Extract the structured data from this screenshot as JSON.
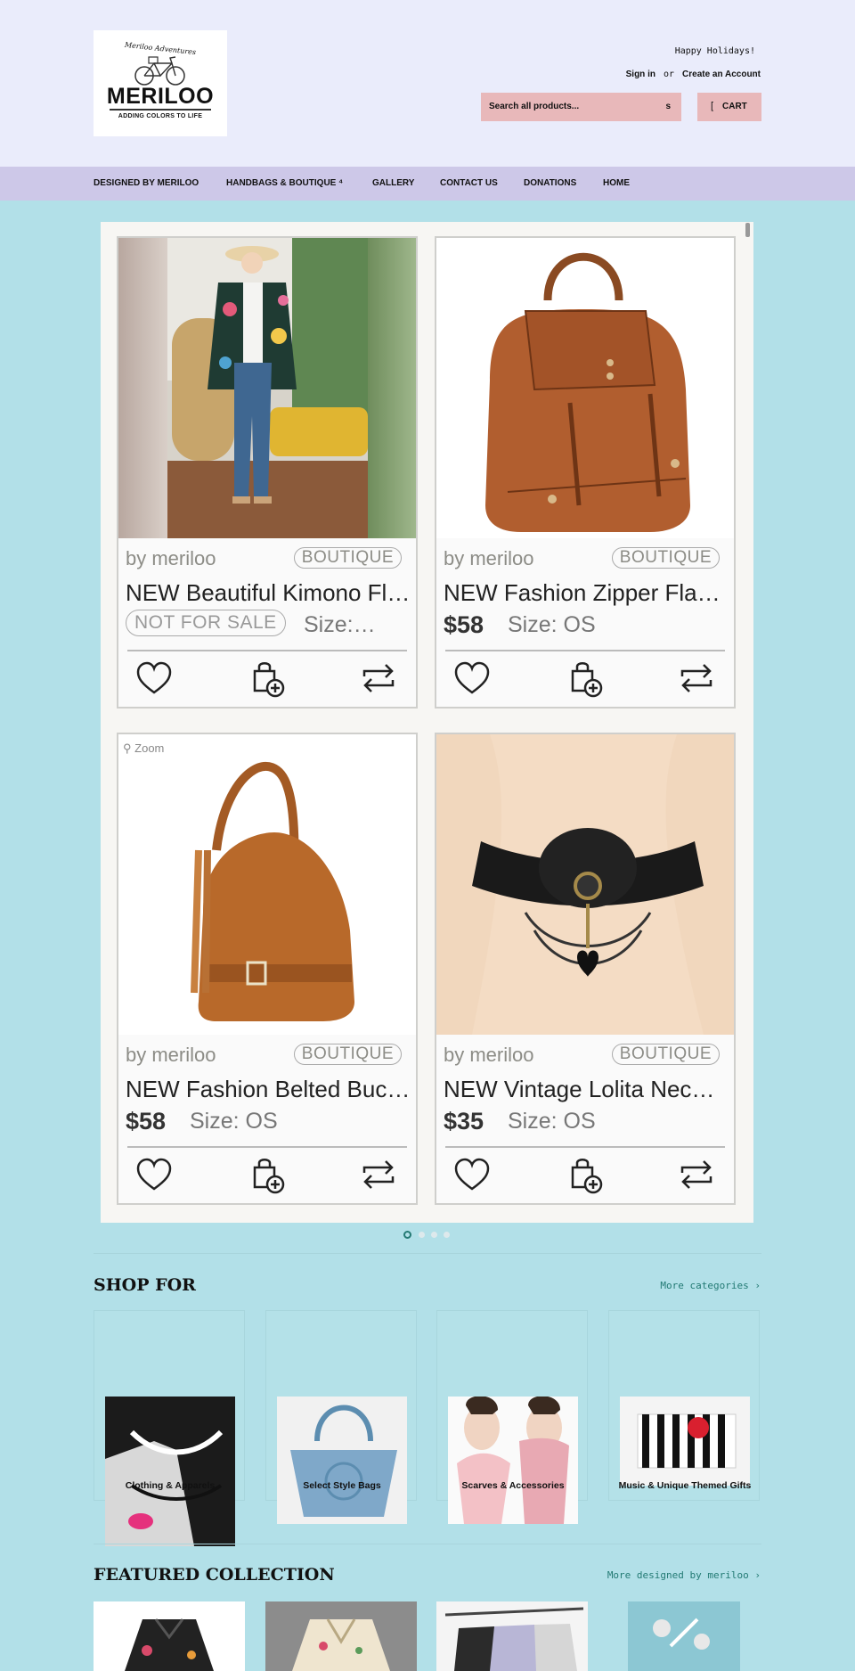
{
  "header": {
    "logo": {
      "script_text": "Meriloo Adventures",
      "brand": "MERILOO",
      "tagline": "ADDING COLORS TO LIFE"
    },
    "announcement": "Happy Holidays!",
    "sign_in": "Sign in",
    "or": "or",
    "create_account": "Create an Account",
    "search": {
      "placeholder": "Search all products...",
      "icon_glyph": "s"
    },
    "cart": {
      "icon_glyph": "[",
      "label": "CART"
    }
  },
  "nav": {
    "items": [
      {
        "label": "DESIGNED BY MERILOO"
      },
      {
        "label": "HANDBAGS & BOUTIQUE",
        "caret": "⁴"
      },
      {
        "label": "GALLERY"
      },
      {
        "label": "CONTACT US"
      },
      {
        "label": "DONATIONS"
      },
      {
        "label": "HOME"
      }
    ]
  },
  "carousel": {
    "zoom_label": "Zoom",
    "products": [
      {
        "by": "by meriloo",
        "badge": "BOUTIQUE",
        "title": "NEW Beautiful Kimono Fl…",
        "price_tag": "NOT FOR SALE",
        "size": "Size:…"
      },
      {
        "by": "by meriloo",
        "badge": "BOUTIQUE",
        "title": "NEW Fashion Zipper Fla…",
        "price": "$58",
        "size": "Size: OS"
      },
      {
        "by": "by meriloo",
        "badge": "BOUTIQUE",
        "title": "NEW Fashion Belted Buc…",
        "price": "$58",
        "size": "Size: OS"
      },
      {
        "by": "by meriloo",
        "badge": "BOUTIQUE",
        "title": "NEW Vintage Lolita Nec…",
        "price": "$35",
        "size": "Size: OS"
      }
    ],
    "page_count": 4,
    "active_page": 1
  },
  "shop_for": {
    "title": "SHOP FOR",
    "more_link": "More categories ›",
    "categories": [
      {
        "label": "Clothing & Apparels"
      },
      {
        "label": "Select Style Bags"
      },
      {
        "label": "Scarves & Accessories"
      },
      {
        "label": "Music & Unique Themed Gifts"
      }
    ]
  },
  "featured": {
    "title": "FEATURED COLLECTION",
    "more_link": "More designed by meriloo ›"
  },
  "colors": {
    "header_bg": "#eaecfb",
    "nav_bg": "#cdc8e8",
    "page_bg": "#b2e0e8",
    "button_bg": "#e8b8ba",
    "link_color": "#237a74"
  }
}
